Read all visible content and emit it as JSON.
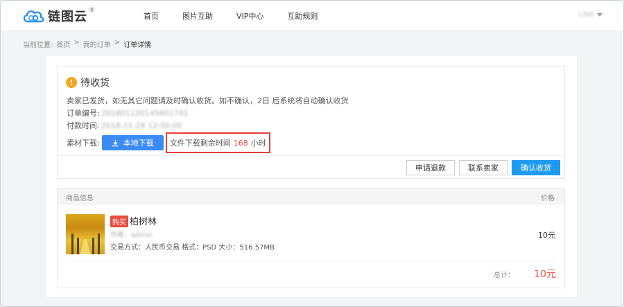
{
  "header": {
    "logo_text": "链图云",
    "logo_reg": "®",
    "nav": [
      "首页",
      "图片互助",
      "VIP中心",
      "互助规则"
    ],
    "user_name": "LINK"
  },
  "breadcrumb": {
    "prefix": "当前位置:",
    "items": [
      "首页",
      "我的订单"
    ],
    "separator": ">",
    "current": "订单详情"
  },
  "order": {
    "status": "待收货",
    "notice": "卖家已发货，如无其它问题请及时确认收货。如不确认，2日 后系统将自动确认收货",
    "order_no_label": "订单编号:",
    "order_no": "201801120145601741",
    "pay_time_label": "付款时间:",
    "pay_time": "2018-11-28 12:00:00",
    "download_label": "素材下载:",
    "download_button": "本地下载",
    "remain_prefix": "文件下载剩余时间",
    "remain_hours": "168",
    "remain_suffix": "小时",
    "actions": {
      "refund": "申请退款",
      "contact": "联系卖家",
      "confirm": "确认收货"
    }
  },
  "goods": {
    "head_info": "商品信息",
    "head_price": "价格",
    "badge": "购买",
    "name": "柏树林",
    "author": "作者：admin",
    "meta": "交易方式：人民币交易 格式：PSD  大小：516.57MB",
    "price": "10元",
    "total_label": "总计：",
    "total_value": "10元"
  },
  "colors": {
    "primary_blue": "#3b8bf5",
    "confirm_blue": "#1e9bf0",
    "accent_red": "#f04b3e",
    "warning_orange": "#f5a623"
  }
}
